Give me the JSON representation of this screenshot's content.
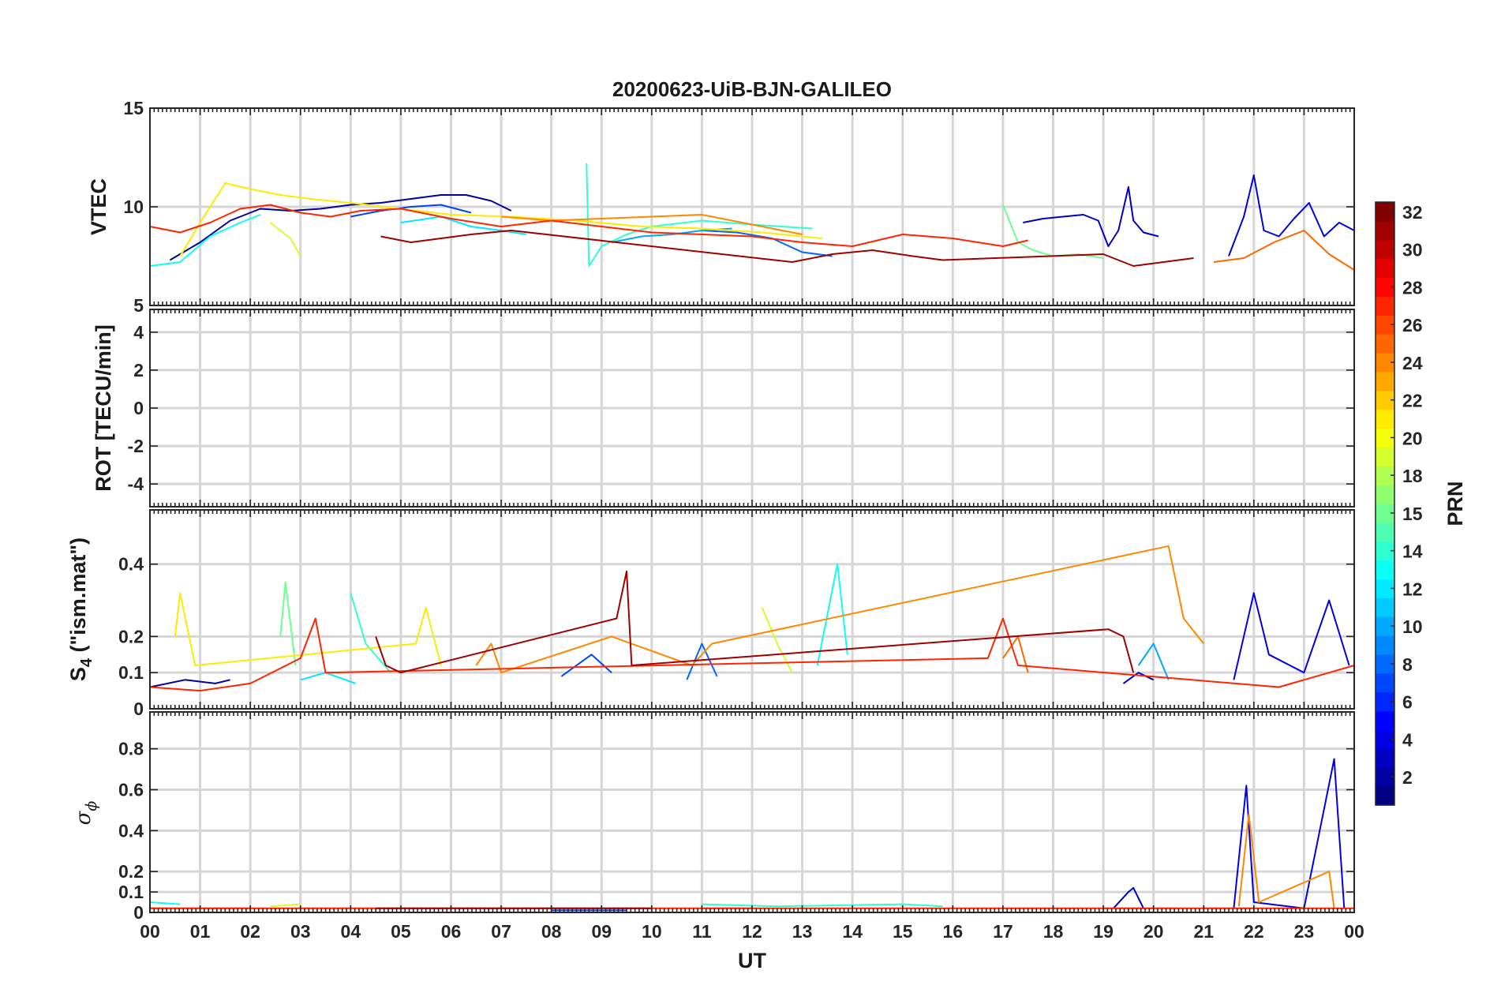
{
  "chart_data": {
    "type": "line",
    "title": "20200623-UiB-BJN-GALILEO",
    "xlabel": "UT",
    "x_tick_labels": [
      "00",
      "01",
      "02",
      "03",
      "04",
      "05",
      "06",
      "07",
      "08",
      "09",
      "10",
      "11",
      "12",
      "13",
      "14",
      "15",
      "16",
      "17",
      "18",
      "19",
      "20",
      "21",
      "22",
      "23",
      "00"
    ],
    "xlim_hours": [
      0,
      24
    ],
    "grid": true,
    "panels": [
      {
        "id": "vtec",
        "ylabel": "VTEC",
        "ylim": [
          5,
          15
        ],
        "yticks": [
          5,
          10,
          15
        ],
        "ytick_labels": [
          "5",
          "10",
          "15"
        ]
      },
      {
        "id": "rot",
        "ylabel": "ROT [TECU/min]",
        "ylim": [
          -5.2,
          5.2
        ],
        "yticks": [
          -4,
          -2,
          0,
          2,
          4
        ],
        "ytick_labels": [
          "-4",
          "-2",
          "0",
          "2",
          "4"
        ]
      },
      {
        "id": "s4",
        "ylabel_main": "S",
        "ylabel_sub": "4",
        "ylabel_rest": " (\"ism.mat\")",
        "ylim": [
          0,
          0.55
        ],
        "yticks": [
          0,
          0.1,
          0.2,
          0.4
        ],
        "ytick_labels": [
          "0",
          "0.1",
          "0.2",
          "0.4"
        ]
      },
      {
        "id": "sigma",
        "ylabel_main": "σ",
        "ylabel_sub": "ϕ",
        "ylim": [
          0,
          0.98
        ],
        "yticks": [
          0,
          0.1,
          0.2,
          0.4,
          0.6,
          0.8
        ],
        "ytick_labels": [
          "0",
          "0.1",
          "0.2",
          "0.4",
          "0.6",
          "0.8"
        ]
      }
    ],
    "colorbar": {
      "label": "PRN",
      "colormap": "jet",
      "range": [
        1,
        32
      ],
      "ticks": [
        2,
        4,
        6,
        8,
        10,
        12,
        14,
        16,
        18,
        20,
        22,
        24,
        26,
        28,
        30,
        32
      ],
      "tick_labels": [
        "2",
        "4",
        "6",
        "8",
        "10",
        "12",
        "14",
        "15",
        "18",
        "20",
        "22",
        "24",
        "26",
        "28",
        "30",
        "32"
      ]
    },
    "series": [
      {
        "prn": 2,
        "vtec": [
          [
            0.4,
            7.3
          ],
          [
            1.0,
            8.2
          ],
          [
            1.6,
            9.3
          ],
          [
            2.2,
            9.9
          ],
          [
            2.8,
            9.8
          ],
          [
            3.4,
            9.9
          ],
          [
            4.0,
            10.1
          ],
          [
            4.6,
            10.2
          ],
          [
            5.2,
            10.4
          ],
          [
            5.8,
            10.6
          ],
          [
            6.3,
            10.6
          ],
          [
            6.8,
            10.3
          ],
          [
            7.2,
            9.8
          ]
        ],
        "s4": [
          [
            0.0,
            0.06
          ],
          [
            0.7,
            0.08
          ],
          [
            1.3,
            0.07
          ],
          [
            1.6,
            0.08
          ]
        ],
        "sigma": [
          [
            0.0,
            0.02
          ],
          [
            2.0,
            0.02
          ]
        ]
      },
      {
        "prn": 3,
        "vtec": [
          [
            17.4,
            9.2
          ],
          [
            17.8,
            9.4
          ],
          [
            18.2,
            9.5
          ],
          [
            18.6,
            9.6
          ],
          [
            18.9,
            9.3
          ],
          [
            19.1,
            8.0
          ],
          [
            19.3,
            8.8
          ],
          [
            19.5,
            11.0
          ],
          [
            19.6,
            9.3
          ],
          [
            19.8,
            8.7
          ],
          [
            20.1,
            8.5
          ]
        ],
        "s4": [
          [
            19.4,
            0.07
          ],
          [
            19.7,
            0.1
          ],
          [
            20.0,
            0.08
          ]
        ],
        "sigma": [
          [
            19.2,
            0.02
          ],
          [
            19.5,
            0.1
          ],
          [
            19.6,
            0.12
          ],
          [
            19.8,
            0.02
          ]
        ]
      },
      {
        "prn": 4,
        "vtec": [
          [
            21.5,
            7.5
          ],
          [
            21.8,
            9.5
          ],
          [
            22.0,
            11.6
          ],
          [
            22.2,
            8.8
          ],
          [
            22.5,
            8.5
          ],
          [
            22.8,
            9.4
          ],
          [
            23.1,
            10.2
          ],
          [
            23.4,
            8.5
          ],
          [
            23.7,
            9.2
          ],
          [
            24.0,
            8.8
          ]
        ],
        "s4": [
          [
            21.6,
            0.08
          ],
          [
            22.0,
            0.32
          ],
          [
            22.3,
            0.15
          ],
          [
            23.0,
            0.1
          ],
          [
            23.5,
            0.3
          ],
          [
            23.9,
            0.12
          ]
        ],
        "sigma": [
          [
            21.6,
            0.02
          ],
          [
            21.85,
            0.62
          ],
          [
            22.0,
            0.05
          ],
          [
            23.0,
            0.02
          ],
          [
            23.6,
            0.75
          ],
          [
            23.8,
            0.02
          ]
        ]
      },
      {
        "prn": 7,
        "vtec": [
          [
            4.0,
            9.5
          ],
          [
            4.6,
            9.8
          ],
          [
            5.2,
            10.0
          ],
          [
            5.8,
            10.1
          ],
          [
            6.4,
            9.7
          ]
        ],
        "s4": [
          [
            8.2,
            0.09
          ],
          [
            8.8,
            0.15
          ],
          [
            9.2,
            0.1
          ]
        ],
        "sigma": [
          [
            8.0,
            0.01
          ],
          [
            9.5,
            0.01
          ]
        ]
      },
      {
        "prn": 8,
        "vtec": [
          [
            11.0,
            8.8
          ],
          [
            11.7,
            8.7
          ],
          [
            12.4,
            8.4
          ],
          [
            13.0,
            7.7
          ],
          [
            13.6,
            7.5
          ]
        ],
        "s4": [
          [
            10.7,
            0.08
          ],
          [
            11.0,
            0.18
          ],
          [
            11.3,
            0.09
          ]
        ],
        "sigma": [
          [
            11.0,
            0.02
          ],
          [
            12.0,
            0.02
          ]
        ]
      },
      {
        "prn": 10,
        "vtec": [
          [
            9.2,
            8.2
          ],
          [
            9.8,
            8.5
          ],
          [
            10.4,
            8.6
          ],
          [
            11.0,
            8.8
          ],
          [
            11.6,
            8.9
          ]
        ],
        "s4": [
          [
            19.7,
            0.12
          ],
          [
            20.0,
            0.18
          ],
          [
            20.3,
            0.08
          ]
        ],
        "sigma": [
          [
            19.0,
            0.02
          ],
          [
            20.5,
            0.02
          ]
        ]
      },
      {
        "prn": 12,
        "vtec": [
          [
            5.0,
            9.2
          ],
          [
            5.8,
            9.5
          ],
          [
            6.4,
            9.0
          ],
          [
            7.0,
            8.8
          ],
          [
            7.5,
            8.6
          ]
        ],
        "s4": [
          [
            3.0,
            0.08
          ],
          [
            3.5,
            0.1
          ],
          [
            4.1,
            0.07
          ]
        ],
        "sigma": [
          [
            3.0,
            0.02
          ],
          [
            4.5,
            0.02
          ]
        ]
      },
      {
        "prn": 13,
        "vtec": [
          [
            0.0,
            7.0
          ],
          [
            0.6,
            7.2
          ],
          [
            1.2,
            8.5
          ],
          [
            1.8,
            9.2
          ],
          [
            2.2,
            9.6
          ]
        ],
        "s4": [
          [
            13.3,
            0.12
          ],
          [
            13.7,
            0.4
          ],
          [
            13.9,
            0.15
          ]
        ],
        "sigma": [
          [
            0.0,
            0.05
          ],
          [
            0.6,
            0.04
          ]
        ]
      },
      {
        "prn": 14,
        "vtec": [
          [
            8.7,
            12.2
          ],
          [
            8.75,
            7.0
          ],
          [
            9.0,
            8.0
          ],
          [
            9.5,
            8.6
          ],
          [
            10.0,
            9.0
          ],
          [
            11.0,
            9.3
          ],
          [
            12.0,
            9.1
          ],
          [
            13.2,
            8.9
          ]
        ],
        "s4": [
          [
            4.0,
            0.32
          ],
          [
            4.3,
            0.18
          ],
          [
            4.8,
            0.1
          ]
        ],
        "sigma": [
          [
            11.0,
            0.04
          ],
          [
            12.5,
            0.03
          ],
          [
            15.0,
            0.04
          ],
          [
            15.8,
            0.03
          ]
        ]
      },
      {
        "prn": 16,
        "vtec": [
          [
            17.0,
            10.1
          ],
          [
            17.3,
            8.2
          ],
          [
            17.6,
            7.8
          ],
          [
            18.0,
            7.5
          ],
          [
            18.5,
            7.6
          ],
          [
            19.0,
            7.4
          ]
        ],
        "s4": [
          [
            2.6,
            0.2
          ],
          [
            2.7,
            0.35
          ],
          [
            2.9,
            0.12
          ]
        ],
        "sigma": [
          [
            17.0,
            0.02
          ],
          [
            18.5,
            0.02
          ]
        ]
      },
      {
        "prn": 19,
        "vtec": [
          [
            2.4,
            9.2
          ],
          [
            2.8,
            8.4
          ],
          [
            3.0,
            7.5
          ]
        ],
        "s4": [
          [
            12.2,
            0.28
          ],
          [
            12.5,
            0.18
          ],
          [
            12.8,
            0.1
          ]
        ],
        "sigma": [
          [
            2.4,
            0.03
          ],
          [
            3.0,
            0.04
          ]
        ]
      },
      {
        "prn": 21,
        "vtec": [
          [
            0.6,
            7.5
          ],
          [
            1.0,
            9.2
          ],
          [
            1.5,
            11.2
          ],
          [
            2.0,
            10.9
          ],
          [
            2.6,
            10.6
          ],
          [
            3.2,
            10.4
          ],
          [
            4.0,
            10.2
          ],
          [
            5.0,
            9.9
          ],
          [
            6.0,
            9.6
          ],
          [
            7.2,
            9.5
          ],
          [
            8.5,
            9.3
          ],
          [
            9.8,
            9.0
          ],
          [
            11.0,
            8.9
          ],
          [
            12.2,
            8.7
          ],
          [
            13.4,
            8.4
          ]
        ],
        "s4": [
          [
            0.5,
            0.2
          ],
          [
            0.6,
            0.32
          ],
          [
            0.9,
            0.12
          ],
          [
            5.3,
            0.18
          ],
          [
            5.5,
            0.28
          ],
          [
            5.8,
            0.12
          ]
        ],
        "sigma": [
          [
            0.0,
            0.02
          ],
          [
            3.0,
            0.02
          ]
        ]
      },
      {
        "prn": 24,
        "vtec": [
          [
            7.0,
            9.5
          ],
          [
            8.0,
            9.3
          ],
          [
            9.0,
            9.4
          ],
          [
            10.0,
            9.5
          ],
          [
            11.0,
            9.6
          ],
          [
            12.0,
            9.1
          ],
          [
            13.0,
            8.6
          ]
        ],
        "s4": [
          [
            6.5,
            0.12
          ],
          [
            6.8,
            0.18
          ],
          [
            7.0,
            0.1
          ],
          [
            9.2,
            0.2
          ],
          [
            10.8,
            0.12
          ],
          [
            11.2,
            0.18
          ],
          [
            20.3,
            0.45
          ],
          [
            20.6,
            0.25
          ],
          [
            21.0,
            0.18
          ]
        ],
        "sigma": [
          [
            21.7,
            0.03
          ],
          [
            21.9,
            0.48
          ],
          [
            22.1,
            0.05
          ],
          [
            23.5,
            0.2
          ],
          [
            23.6,
            0.02
          ]
        ]
      },
      {
        "prn": 25,
        "vtec": [
          [
            21.2,
            7.2
          ],
          [
            21.8,
            7.4
          ],
          [
            22.4,
            8.2
          ],
          [
            23.0,
            8.8
          ],
          [
            23.5,
            7.6
          ],
          [
            24.0,
            6.8
          ]
        ],
        "s4": [
          [
            17.0,
            0.14
          ],
          [
            17.3,
            0.2
          ],
          [
            17.5,
            0.1
          ]
        ],
        "sigma": [
          [
            21.0,
            0.02
          ],
          [
            22.0,
            0.02
          ]
        ]
      },
      {
        "prn": 27,
        "vtec": [
          [
            0.0,
            9.0
          ],
          [
            0.6,
            8.7
          ],
          [
            1.2,
            9.2
          ],
          [
            1.8,
            9.9
          ],
          [
            2.4,
            10.1
          ],
          [
            3.0,
            9.7
          ],
          [
            3.6,
            9.5
          ],
          [
            4.2,
            9.8
          ],
          [
            5.0,
            9.9
          ],
          [
            6.0,
            9.4
          ],
          [
            7.0,
            9.0
          ],
          [
            8.0,
            9.3
          ],
          [
            9.0,
            9.0
          ],
          [
            10.0,
            8.7
          ],
          [
            11.0,
            8.6
          ],
          [
            12.0,
            8.5
          ],
          [
            13.0,
            8.2
          ],
          [
            14.0,
            8.0
          ],
          [
            15.0,
            8.6
          ],
          [
            16.0,
            8.4
          ],
          [
            17.0,
            8.0
          ],
          [
            17.5,
            8.3
          ]
        ],
        "s4": [
          [
            0.0,
            0.06
          ],
          [
            1.0,
            0.05
          ],
          [
            2.0,
            0.07
          ],
          [
            3.0,
            0.14
          ],
          [
            3.3,
            0.25
          ],
          [
            3.5,
            0.1
          ],
          [
            16.7,
            0.14
          ],
          [
            17.0,
            0.25
          ],
          [
            17.3,
            0.12
          ],
          [
            22.5,
            0.06
          ],
          [
            23.5,
            0.1
          ],
          [
            24.0,
            0.12
          ]
        ],
        "sigma": [
          [
            0.0,
            0.02
          ],
          [
            24.0,
            0.02
          ]
        ]
      },
      {
        "prn": 31,
        "vtec": [
          [
            4.6,
            8.5
          ],
          [
            5.2,
            8.2
          ],
          [
            5.8,
            8.4
          ],
          [
            6.4,
            8.6
          ],
          [
            7.2,
            8.8
          ],
          [
            12.8,
            7.2
          ],
          [
            13.6,
            7.6
          ],
          [
            14.4,
            7.8
          ],
          [
            15.2,
            7.5
          ],
          [
            15.8,
            7.3
          ],
          [
            19.0,
            7.6
          ],
          [
            19.6,
            7.0
          ],
          [
            20.2,
            7.2
          ],
          [
            20.8,
            7.4
          ]
        ],
        "s4": [
          [
            4.5,
            0.2
          ],
          [
            4.7,
            0.12
          ],
          [
            5.0,
            0.1
          ],
          [
            9.3,
            0.25
          ],
          [
            9.5,
            0.38
          ],
          [
            9.6,
            0.12
          ],
          [
            19.1,
            0.22
          ],
          [
            19.4,
            0.2
          ],
          [
            19.6,
            0.1
          ]
        ],
        "sigma": [
          [
            4.5,
            0.02
          ],
          [
            10.0,
            0.02
          ]
        ]
      }
    ]
  }
}
